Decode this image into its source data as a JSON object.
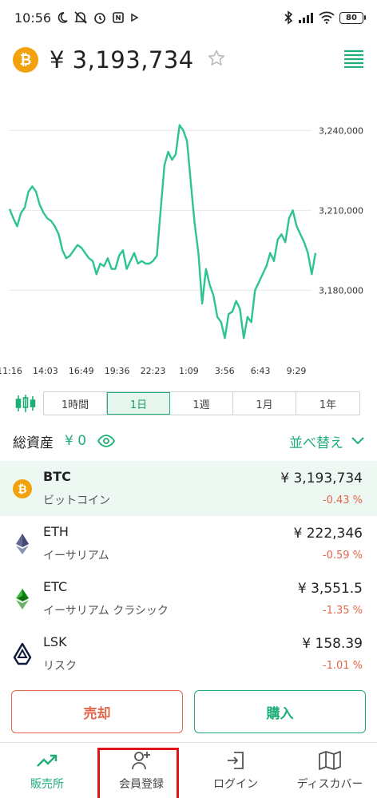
{
  "status_bar": {
    "time": "10:56",
    "battery": "80"
  },
  "header": {
    "coin_symbol_badge": "₿",
    "price": "¥ 3,193,734",
    "star_icon": "star-outline-icon",
    "menu_icon": "list-menu-icon"
  },
  "chart_data": {
    "type": "line",
    "title": "",
    "xlabel": "",
    "ylabel": "",
    "x_tick_labels": [
      "11:16",
      "14:03",
      "16:49",
      "19:36",
      "22:23",
      "1:09",
      "3:56",
      "6:43",
      "9:29"
    ],
    "y_tick_labels": [
      "3,240,000",
      "3,210,000",
      "3,180,000"
    ],
    "y_ticks": [
      3240000,
      3210000,
      3180000
    ],
    "ylim": [
      3160000,
      3250000
    ],
    "grid": true,
    "color": "#2ec48f",
    "series": [
      {
        "values": [
          3210500,
          3207000,
          3204000,
          3209000,
          3211000,
          3217000,
          3219000,
          3217000,
          3212000,
          3209000,
          3207000,
          3206000,
          3204000,
          3201000,
          3195000,
          3192000,
          3193000,
          3195000,
          3197000,
          3196000,
          3194000,
          3192000,
          3191000,
          3186000,
          3190000,
          3189000,
          3192000,
          3188000,
          3188000,
          3193000,
          3195000,
          3188000,
          3191000,
          3194000,
          3190000,
          3191000,
          3190000,
          3190000,
          3191000,
          3193000,
          3210000,
          3227000,
          3232000,
          3229000,
          3231000,
          3242000,
          3240000,
          3236000,
          3220000,
          3205000,
          3194000,
          3175000,
          3188000,
          3182000,
          3178000,
          3170000,
          3168000,
          3162000,
          3171000,
          3172000,
          3176000,
          3173000,
          3162000,
          3170000,
          3168000,
          3180000,
          3183000,
          3186000,
          3189000,
          3194000,
          3191000,
          3199000,
          3201000,
          3198000,
          3207000,
          3210000,
          3204000,
          3201000,
          3198000,
          3194000,
          3186000,
          3194000
        ]
      }
    ]
  },
  "periods": {
    "items": [
      "1時間",
      "1日",
      "1週",
      "1月",
      "1年"
    ],
    "active": "1日"
  },
  "assets": {
    "label": "総資産",
    "value": "¥ 0",
    "sort_label": "並べ替え"
  },
  "coins": [
    {
      "symbol": "BTC",
      "name": "ビットコイン",
      "price": "¥ 3,193,734",
      "change": "-0.43 %",
      "icon": "bitcoin-icon",
      "selected": true
    },
    {
      "symbol": "ETH",
      "name": "イーサリアム",
      "price": "¥ 222,346",
      "change": "-0.59 %",
      "icon": "ethereum-icon",
      "selected": false
    },
    {
      "symbol": "ETC",
      "name": "イーサリアム クラシック",
      "price": "¥ 3,551.5",
      "change": "-1.35 %",
      "icon": "ethereum-classic-icon",
      "selected": false
    },
    {
      "symbol": "LSK",
      "name": "リスク",
      "price": "¥ 158.39",
      "change": "-1.01 %",
      "icon": "lisk-icon",
      "selected": false
    }
  ],
  "actions": {
    "sell": "売却",
    "buy": "購入"
  },
  "nav": {
    "items": [
      {
        "label": "販売所",
        "icon": "trending-up-icon"
      },
      {
        "label": "会員登録",
        "icon": "add-user-icon"
      },
      {
        "label": "ログイン",
        "icon": "login-icon"
      },
      {
        "label": "ディスカバー",
        "icon": "map-icon"
      }
    ]
  },
  "colors": {
    "accent": "#1fae78",
    "negative": "#e0664a",
    "bitcoin": "#f2a20d",
    "highlight_box": "#e0151b"
  }
}
